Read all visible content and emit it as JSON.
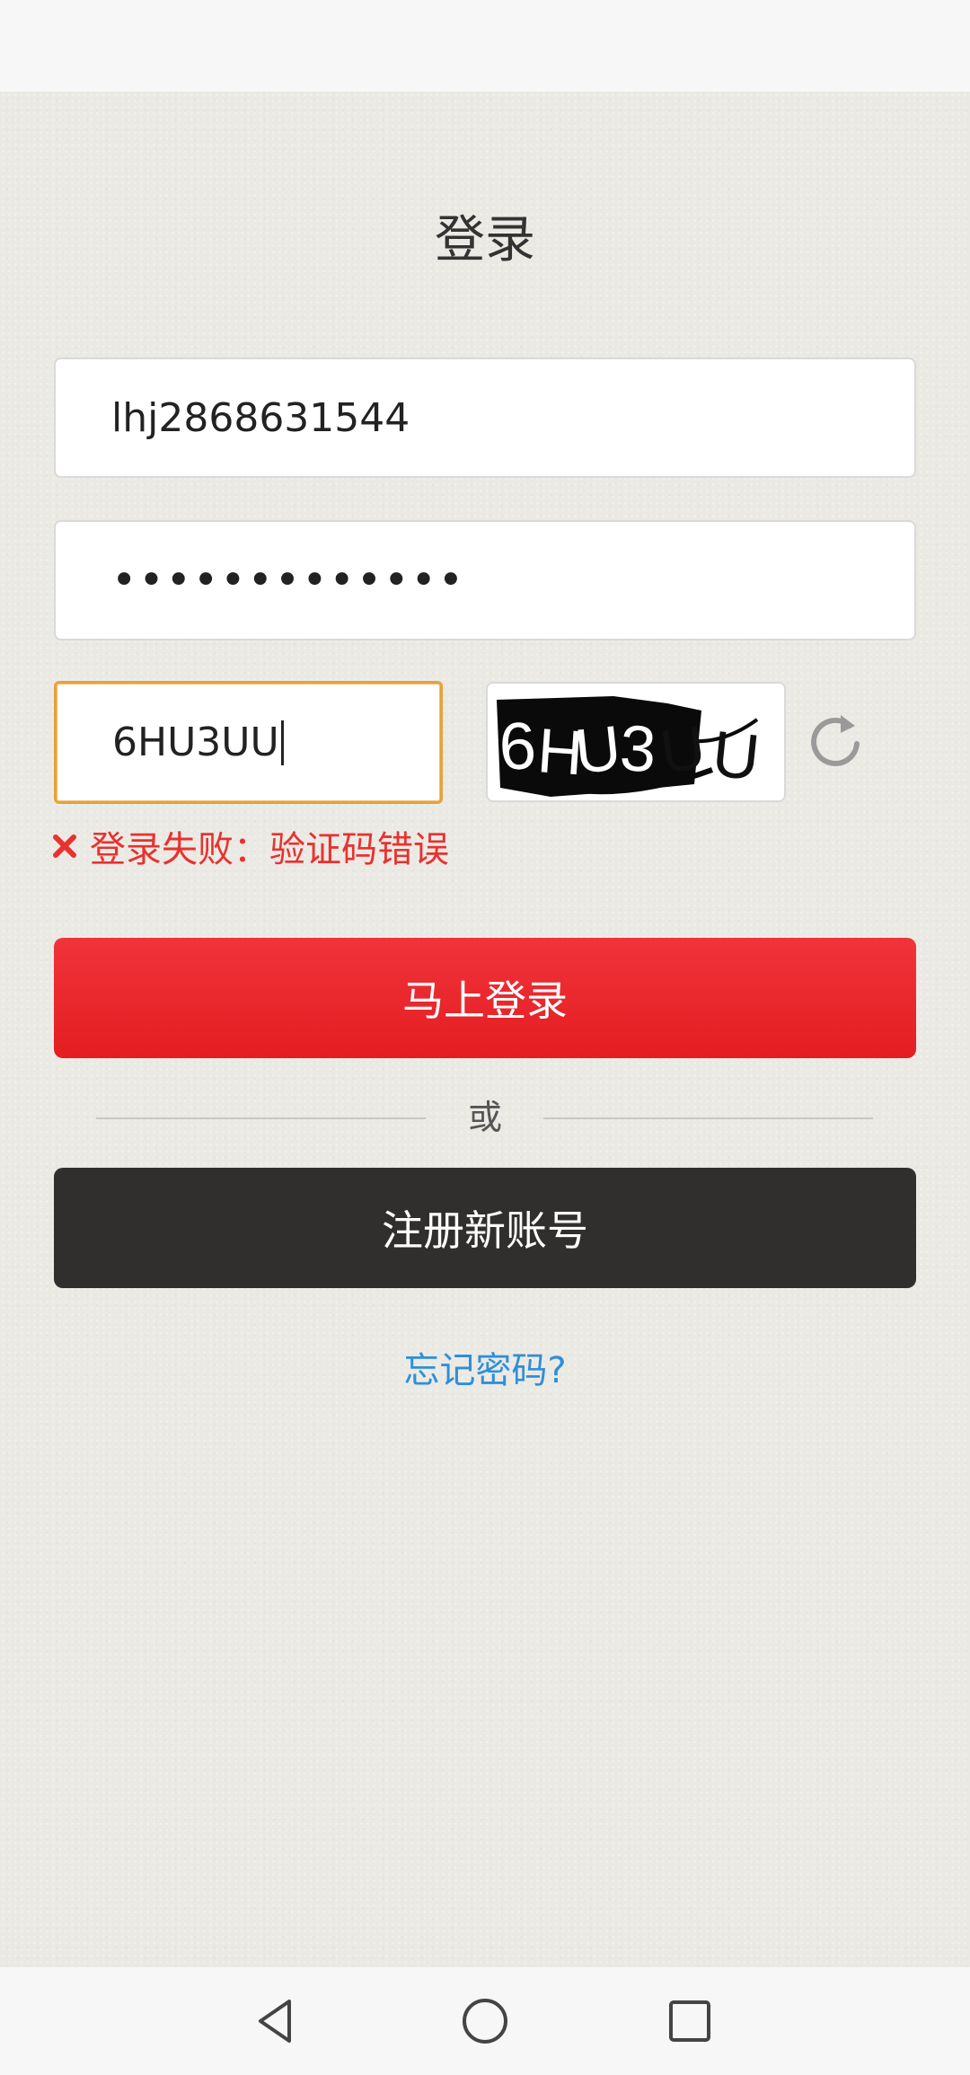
{
  "page": {
    "title": "登录"
  },
  "form": {
    "username_value": "lhj2868631544",
    "password_masked": "•••••••••••••",
    "captcha_value": "6HU3UU",
    "captcha_image_text": "6HU3UU"
  },
  "error": {
    "message": "登录失败：验证码错误",
    "color": "#e8322f"
  },
  "buttons": {
    "login_label": "马上登录",
    "or_label": "或",
    "register_label": "注册新账号",
    "forgot_label": "忘记密码?"
  },
  "icons": {
    "refresh": "refresh-icon",
    "error": "close-icon",
    "nav_back": "back-triangle-icon",
    "nav_home": "home-circle-icon",
    "nav_recent": "recent-square-icon"
  },
  "colors": {
    "accent_red": "#e41d22",
    "register_dark": "#312f2e",
    "link_blue": "#2f8fd8",
    "captcha_focus_border": "#e6a23c"
  }
}
